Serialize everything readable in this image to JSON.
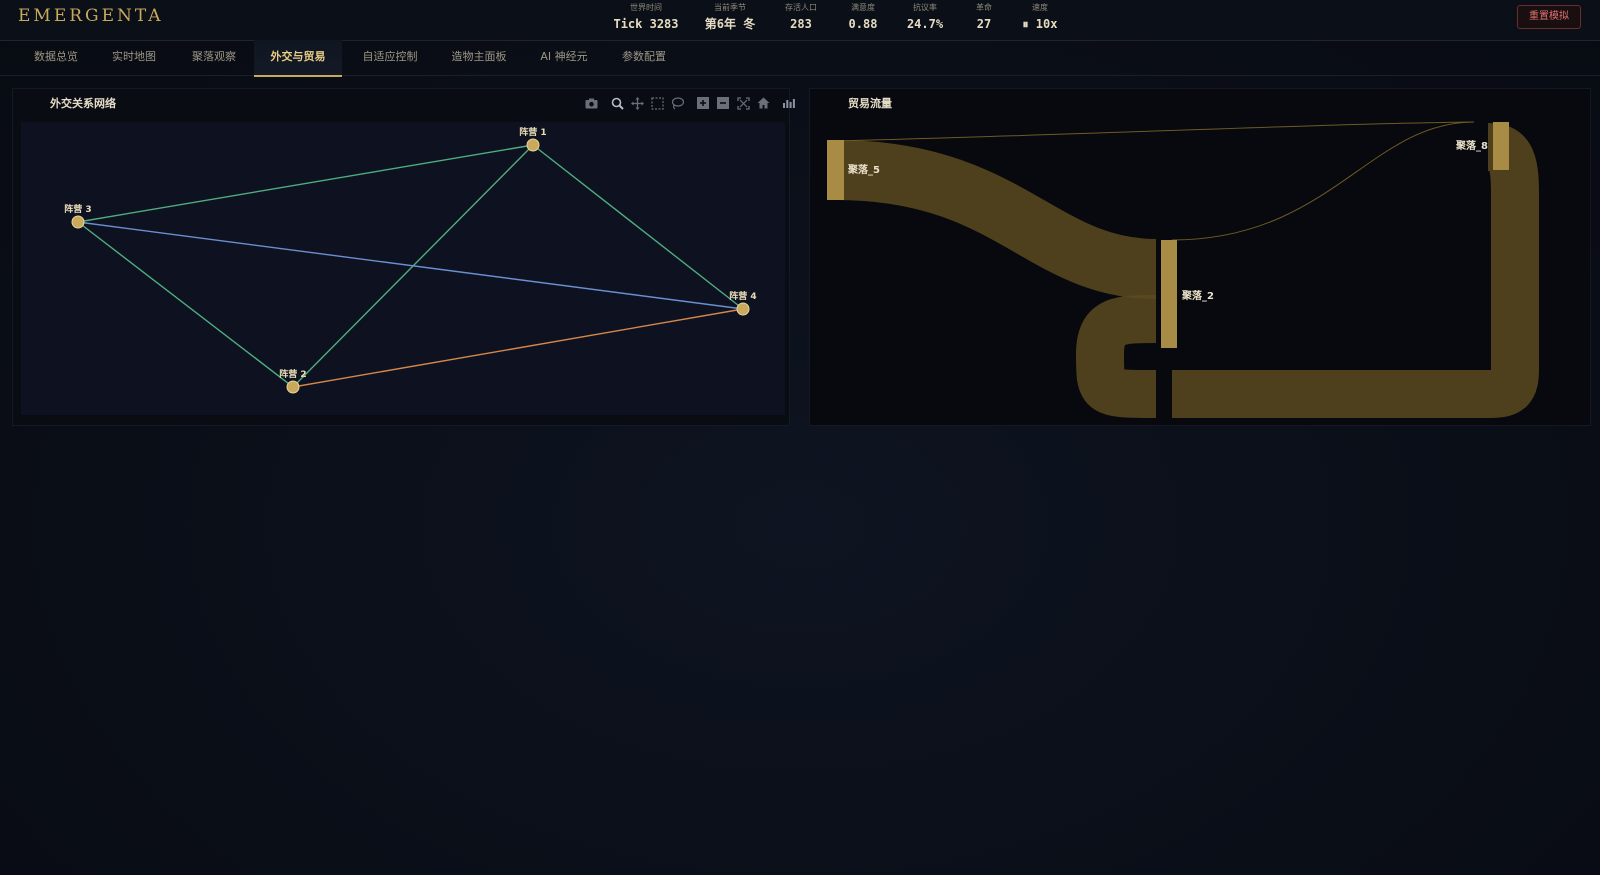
{
  "app": {
    "logo": "EMERGENTA",
    "reset_label": "重置模拟"
  },
  "stats": [
    {
      "label": "世界时间",
      "value": "Tick 3283"
    },
    {
      "label": "当前季节",
      "value": "第6年 冬"
    },
    {
      "label": "存活人口",
      "value": "283"
    },
    {
      "label": "满意度",
      "value": "0.88"
    },
    {
      "label": "抗议率",
      "value": "24.7%"
    },
    {
      "label": "革命",
      "value": "27"
    },
    {
      "label": "速度",
      "value": "⏸ 10x"
    }
  ],
  "tabs": [
    {
      "label": "数据总览"
    },
    {
      "label": "实时地图"
    },
    {
      "label": "聚落观察"
    },
    {
      "label": "外交与贸易",
      "active": true
    },
    {
      "label": "自适应控制"
    },
    {
      "label": "造物主面板"
    },
    {
      "label": "AI 神经元"
    },
    {
      "label": "参数配置"
    }
  ],
  "diplomacy": {
    "title": "外交关系网络",
    "toolbar_icons": [
      "camera-icon",
      "zoom-icon",
      "pan-icon",
      "box-select-icon",
      "lasso-icon",
      "zoom-in-icon",
      "zoom-out-icon",
      "autoscale-icon",
      "home-icon",
      "plotly-logo-icon"
    ],
    "nodes": [
      {
        "label": "阵营 1"
      },
      {
        "label": "阵营 2"
      },
      {
        "label": "阵营 3"
      },
      {
        "label": "阵营 4"
      }
    ],
    "edge_colors": {
      "ally": "#4fae7e",
      "neutral": "#6a8fd0",
      "hostile": "#d4884a"
    },
    "node_color": "#c9a95c"
  },
  "trade": {
    "title": "贸易流量",
    "nodes": [
      {
        "label": "聚落_5"
      },
      {
        "label": "聚落_2"
      },
      {
        "label": "聚落_8"
      }
    ],
    "flow_color": "#5a4a1e",
    "node_color": "#a88b44"
  }
}
